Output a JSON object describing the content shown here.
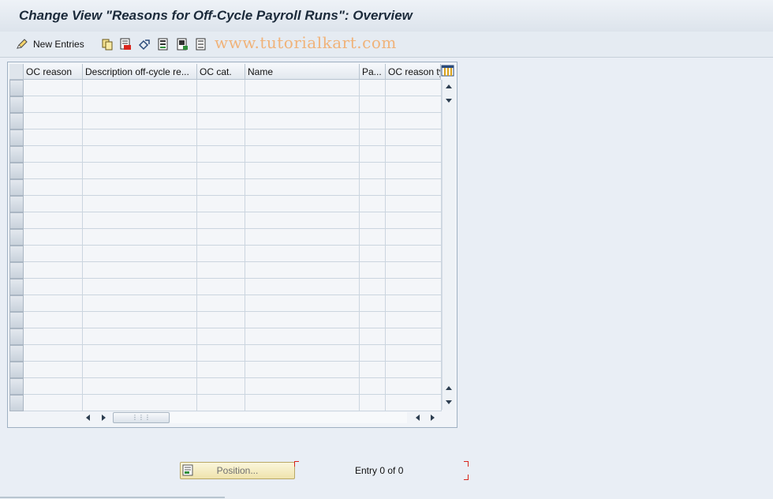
{
  "window": {
    "title": "Change View \"Reasons for Off-Cycle Payroll Runs\": Overview"
  },
  "toolbar": {
    "new_entries_label": "New Entries",
    "icons": [
      "other-view-icon",
      "copy-as-icon",
      "delete-icon",
      "undo-change-icon",
      "select-all-icon",
      "select-block-icon",
      "deselect-all-icon"
    ]
  },
  "watermark": "www.tutorialkart.com",
  "table": {
    "columns": [
      "OC reason",
      "Description off-cycle re...",
      "OC cat.",
      "Name",
      "Pa...",
      "OC reason ty"
    ],
    "rows": [],
    "visible_empty_rows": 20
  },
  "footer": {
    "position_button_label": "Position...",
    "entry_text": "Entry 0 of 0"
  },
  "colors": {
    "background": "#e9eef5",
    "button_yellow": "#efe3ac",
    "accent_red": "#d9251c"
  }
}
